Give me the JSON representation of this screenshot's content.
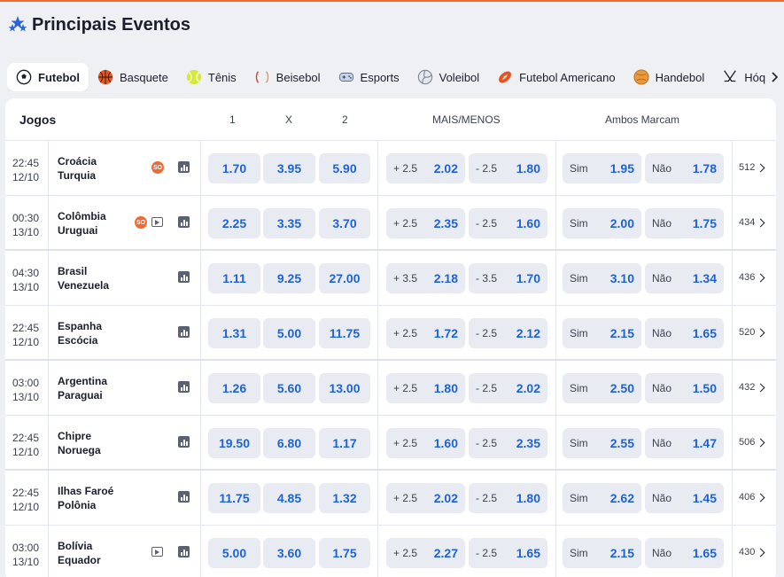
{
  "page": {
    "title": "Principais Eventos",
    "accent_color": "#f06a34",
    "odd_color": "#1f62d6"
  },
  "tabs": [
    {
      "label": "Futebol",
      "icon": "soccer-ball-icon",
      "active": true
    },
    {
      "label": "Basquete",
      "icon": "basketball-icon"
    },
    {
      "label": "Tênis",
      "icon": "tennis-ball-icon"
    },
    {
      "label": "Beisebol",
      "icon": "baseball-icon"
    },
    {
      "label": "Esports",
      "icon": "gamepad-icon"
    },
    {
      "label": "Voleibol",
      "icon": "volleyball-icon"
    },
    {
      "label": "Futebol Americano",
      "icon": "american-football-icon"
    },
    {
      "label": "Handebol",
      "icon": "handball-icon"
    },
    {
      "label": "Hóq",
      "icon": "hockey-icon"
    }
  ],
  "table": {
    "headers": {
      "games": "Jogos",
      "home": "1",
      "draw": "X",
      "away": "2",
      "over_under": "MAIS/MENOS",
      "btts": "Ambos Marcam"
    },
    "btts_yes": "Sim",
    "btts_no": "Não",
    "rows": [
      {
        "time": "22:45",
        "date": "12/10",
        "home": "Croácia",
        "away": "Turquia",
        "so": "SO",
        "has_so": true,
        "has_play": false,
        "o1": "1.70",
        "ox": "3.95",
        "o2": "5.90",
        "over_line": "+ 2.5",
        "over": "2.02",
        "under_line": "- 2.5",
        "under": "1.80",
        "yes": "1.95",
        "no": "1.78",
        "more": "512"
      },
      {
        "time": "00:30",
        "date": "13/10",
        "home": "Colômbia",
        "away": "Uruguai",
        "so": "SO",
        "has_so": true,
        "has_play": true,
        "o1": "2.25",
        "ox": "3.35",
        "o2": "3.70",
        "over_line": "+ 2.5",
        "over": "2.35",
        "under_line": "- 2.5",
        "under": "1.60",
        "yes": "2.00",
        "no": "1.75",
        "more": "434"
      },
      {
        "time": "04:30",
        "date": "13/10",
        "home": "Brasil",
        "away": "Venezuela",
        "has_so": false,
        "has_play": false,
        "o1": "1.11",
        "ox": "9.25",
        "o2": "27.00",
        "over_line": "+ 3.5",
        "over": "2.18",
        "under_line": "- 3.5",
        "under": "1.70",
        "yes": "3.10",
        "no": "1.34",
        "more": "436"
      },
      {
        "time": "22:45",
        "date": "12/10",
        "home": "Espanha",
        "away": "Escócia",
        "has_so": false,
        "has_play": false,
        "o1": "1.31",
        "ox": "5.00",
        "o2": "11.75",
        "over_line": "+ 2.5",
        "over": "1.72",
        "under_line": "- 2.5",
        "under": "2.12",
        "yes": "2.15",
        "no": "1.65",
        "more": "520"
      },
      {
        "time": "03:00",
        "date": "13/10",
        "home": "Argentina",
        "away": "Paraguai",
        "has_so": false,
        "has_play": false,
        "o1": "1.26",
        "ox": "5.60",
        "o2": "13.00",
        "over_line": "+ 2.5",
        "over": "1.80",
        "under_line": "- 2.5",
        "under": "2.02",
        "yes": "2.50",
        "no": "1.50",
        "more": "432"
      },
      {
        "time": "22:45",
        "date": "12/10",
        "home": "Chipre",
        "away": "Noruega",
        "has_so": false,
        "has_play": false,
        "o1": "19.50",
        "ox": "6.80",
        "o2": "1.17",
        "over_line": "+ 2.5",
        "over": "1.60",
        "under_line": "- 2.5",
        "under": "2.35",
        "yes": "2.55",
        "no": "1.47",
        "more": "506"
      },
      {
        "time": "22:45",
        "date": "12/10",
        "home": "Ilhas Faroé",
        "away": "Polônia",
        "has_so": false,
        "has_play": false,
        "o1": "11.75",
        "ox": "4.85",
        "o2": "1.32",
        "over_line": "+ 2.5",
        "over": "2.02",
        "under_line": "- 2.5",
        "under": "1.80",
        "yes": "2.62",
        "no": "1.45",
        "more": "406"
      },
      {
        "time": "03:00",
        "date": "13/10",
        "home": "Bolívia",
        "away": "Equador",
        "has_so": false,
        "has_play": true,
        "o1": "5.00",
        "ox": "3.60",
        "o2": "1.75",
        "over_line": "+ 2.5",
        "over": "2.27",
        "under_line": "- 2.5",
        "under": "1.65",
        "yes": "2.15",
        "no": "1.65",
        "more": "430"
      }
    ]
  }
}
